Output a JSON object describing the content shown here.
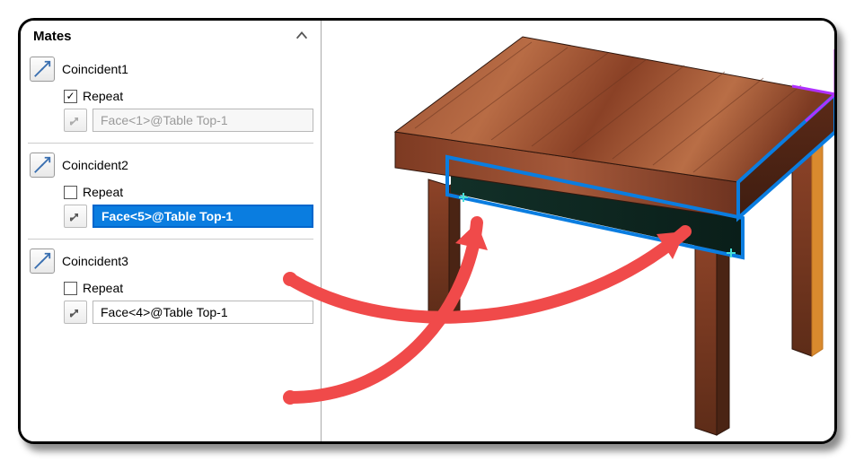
{
  "panel": {
    "title": "Mates",
    "mates": [
      {
        "name": "Coincident1",
        "repeat_label": "Repeat",
        "repeat_checked": true,
        "ref_text": "Face<1>@Table Top-1",
        "ref_state": "disabled"
      },
      {
        "name": "Coincident2",
        "repeat_label": "Repeat",
        "repeat_checked": false,
        "ref_text": "Face<5>@Table Top-1",
        "ref_state": "selected"
      },
      {
        "name": "Coincident3",
        "repeat_label": "Repeat",
        "repeat_checked": false,
        "ref_text": "Face<4>@Table Top-1",
        "ref_state": "normal"
      }
    ]
  },
  "icons": {
    "mate": "coincident-mate-icon",
    "replace_ref": "replace-reference-icon"
  },
  "colors": {
    "selected_bg": "#0a7de0",
    "arrow": "#f04a4a",
    "highlight_edge": "#0a7de0",
    "highlight_corner": "#b030ff",
    "wood_light": "#b5603a",
    "wood_dark": "#6e3320"
  }
}
